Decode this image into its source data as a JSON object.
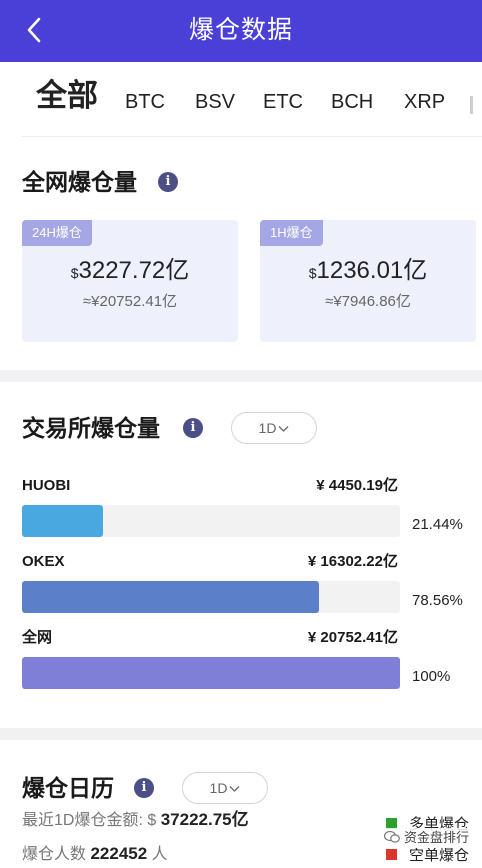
{
  "header": {
    "title": "爆仓数据",
    "back_icon": "chevron-left-icon"
  },
  "tabs": [
    {
      "label": "全部",
      "active": true
    },
    {
      "label": "BTC",
      "active": false
    },
    {
      "label": "BSV",
      "active": false
    },
    {
      "label": "ETC",
      "active": false
    },
    {
      "label": "BCH",
      "active": false
    },
    {
      "label": "XRP",
      "active": false
    }
  ],
  "network": {
    "title": "全网爆仓量",
    "info_icon": "i",
    "cards": [
      {
        "badge": "24H爆仓",
        "currency": "$",
        "value": "3227.72亿",
        "sub": "≈¥20752.41亿"
      },
      {
        "badge": "1H爆仓",
        "currency": "$",
        "value": "1236.01亿",
        "sub": "≈¥7946.86亿"
      }
    ]
  },
  "exchange": {
    "title": "交易所爆仓量",
    "info_icon": "i",
    "period": "1D",
    "rows": [
      {
        "name": "HUOBI",
        "value": "¥ 4450.19亿",
        "percent": "21.44%",
        "ratio": 0.2144,
        "color": "#4aa8e0"
      },
      {
        "name": "OKEX",
        "value": "¥ 16302.22亿",
        "percent": "78.56%",
        "ratio": 0.7856,
        "color": "#5b7fc9"
      },
      {
        "name": "全网",
        "value": "¥ 20752.41亿",
        "percent": "100%",
        "ratio": 1.0,
        "color": "#7f7fd8"
      }
    ]
  },
  "calendar": {
    "title": "爆仓日历",
    "info_icon": "i",
    "period": "1D",
    "amount_label": "最近1D爆仓金额:",
    "amount_currency": "$",
    "amount_value": "37222.75亿",
    "people_label": "爆仓人数",
    "people_value": "222452",
    "people_unit": "人",
    "legend": [
      {
        "label": "多单爆仓",
        "color": "#2ca02c"
      },
      {
        "label": "空单爆仓",
        "color": "#d9372b"
      }
    ]
  },
  "watermark": {
    "icon": "wechat-icon",
    "text": "资金盘排行"
  }
}
